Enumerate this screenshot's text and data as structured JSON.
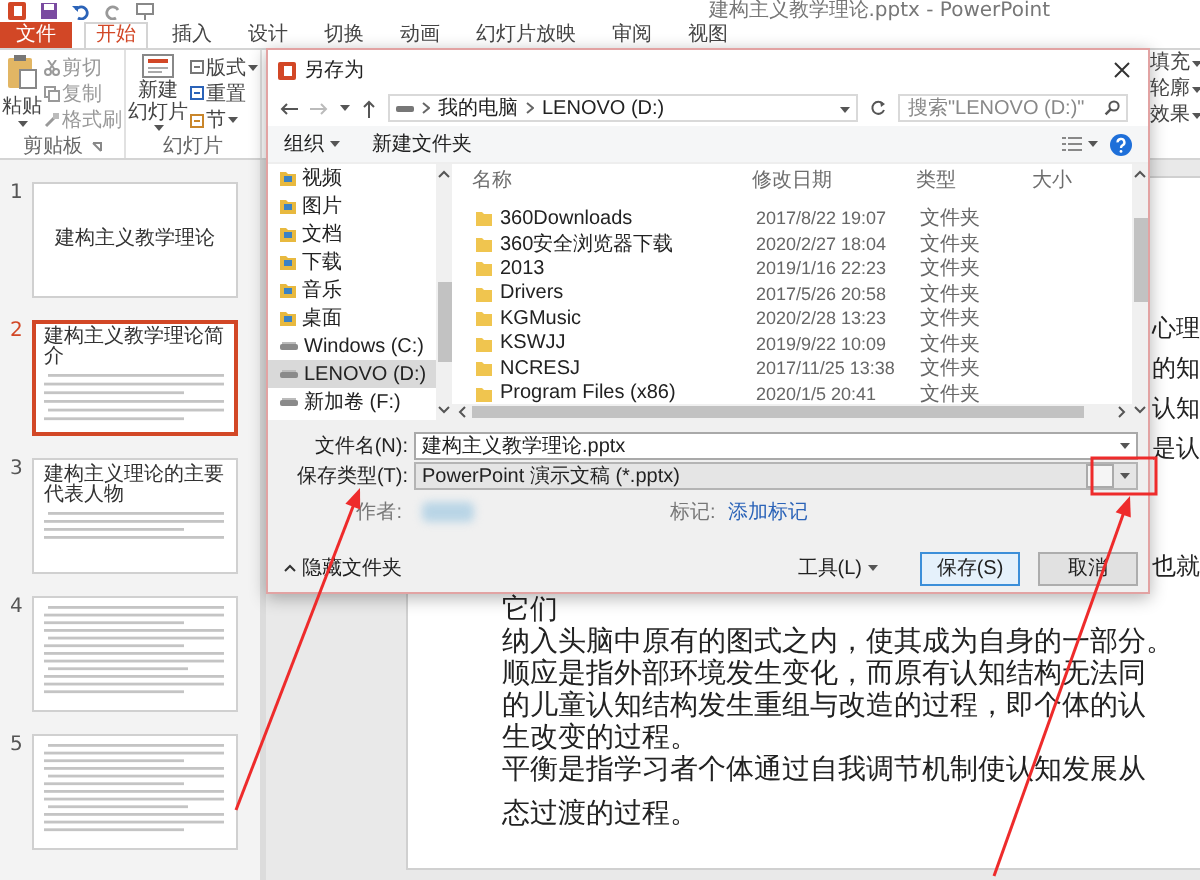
{
  "app": {
    "title": "建构主义教学理论.pptx - PowerPoint"
  },
  "ribbon_tabs": [
    {
      "label": "文件",
      "kind": "file",
      "selected": false
    },
    {
      "label": "开始",
      "kind": "tab",
      "selected": true
    },
    {
      "label": "插入",
      "kind": "tab",
      "selected": false
    },
    {
      "label": "设计",
      "kind": "tab",
      "selected": false
    },
    {
      "label": "切换",
      "kind": "tab",
      "selected": false
    },
    {
      "label": "动画",
      "kind": "tab",
      "selected": false
    },
    {
      "label": "幻灯片放映",
      "kind": "tab",
      "selected": false
    },
    {
      "label": "审阅",
      "kind": "tab",
      "selected": false
    },
    {
      "label": "视图",
      "kind": "tab",
      "selected": false
    }
  ],
  "clipboard_group": {
    "paste": "粘贴",
    "cut": "剪切",
    "copy": "复制",
    "format_painter": "格式刷",
    "label": "剪贴板"
  },
  "slides_group": {
    "new_slide": [
      "新建",
      "幻灯片"
    ],
    "layout": "版式",
    "reset": "重置",
    "section": "节",
    "label": "幻灯片"
  },
  "shape_menu": [
    "填充",
    "轮廓",
    "效果"
  ],
  "slides": [
    {
      "number": "1",
      "kind": "title",
      "title": "建构主义教学理论",
      "selected": false
    },
    {
      "number": "2",
      "kind": "content",
      "title": "建构主义教学理论简介",
      "selected": true
    },
    {
      "number": "3",
      "kind": "content",
      "title": "建构主义理论的主要代表人物",
      "selected": false
    },
    {
      "number": "4",
      "kind": "text",
      "selected": false
    },
    {
      "number": "5",
      "kind": "text",
      "selected": false
    }
  ],
  "slide_text": {
    "fragments": [
      "心理",
      "的知",
      "认知",
      "是认",
      "也就"
    ],
    "lines": [
      "它们",
      "纳入头脑中原有的图式之内，使其成为自身的一部分。",
      "顺应是指外部环境发生变化，而原有认知结构无法同",
      "的儿童认知结构发生重组与改造的过程，即个体的认",
      "生改变的过程。",
      "平衡是指学习者个体通过自我调节机制使认知发展从",
      "态过渡的过程。"
    ]
  },
  "dialog": {
    "title": "另存为",
    "path": [
      "我的电脑",
      "LENOVO (D:)"
    ],
    "search": {
      "placeholder": "搜索\"LENOVO (D:)\""
    },
    "toolbar": {
      "organize": "组织",
      "new_folder": "新建文件夹"
    },
    "sidebar": [
      {
        "label": "视频",
        "kind": "library",
        "selected": false
      },
      {
        "label": "图片",
        "kind": "library",
        "selected": false
      },
      {
        "label": "文档",
        "kind": "library",
        "selected": false
      },
      {
        "label": "下载",
        "kind": "library",
        "selected": false
      },
      {
        "label": "音乐",
        "kind": "library",
        "selected": false
      },
      {
        "label": "桌面",
        "kind": "library",
        "selected": false
      },
      {
        "label": "Windows (C:)",
        "kind": "drive",
        "selected": false
      },
      {
        "label": "LENOVO (D:)",
        "kind": "drive",
        "selected": true
      },
      {
        "label": "新加卷 (F:)",
        "kind": "drive",
        "selected": false
      }
    ],
    "columns": [
      "名称",
      "修改日期",
      "类型",
      "大小"
    ],
    "rows": [
      {
        "name": "360Downloads",
        "modified": "2017/8/22 19:07",
        "type": "文件夹"
      },
      {
        "name": "360安全浏览器下载",
        "modified": "2020/2/27 18:04",
        "type": "文件夹"
      },
      {
        "name": "2013",
        "modified": "2019/1/16 22:23",
        "type": "文件夹"
      },
      {
        "name": "Drivers",
        "modified": "2017/5/26 20:58",
        "type": "文件夹"
      },
      {
        "name": "KGMusic",
        "modified": "2020/2/28 13:23",
        "type": "文件夹"
      },
      {
        "name": "KSWJJ",
        "modified": "2019/9/22 10:09",
        "type": "文件夹"
      },
      {
        "name": "NCRESJ",
        "modified": "2017/11/25 13:38",
        "type": "文件夹"
      },
      {
        "name": "Program Files (x86)",
        "modified": "2020/1/5 20:41",
        "type": "文件夹"
      }
    ],
    "file_name": {
      "label": "文件名(N):",
      "value": "建构主义教学理论.pptx"
    },
    "save_type": {
      "label": "保存类型(T):",
      "value": "PowerPoint 演示文稿 (*.pptx)"
    },
    "author": {
      "label": "作者:"
    },
    "tags": {
      "label": "标记:",
      "link": "添加标记"
    },
    "hide_folders": "隐藏文件夹",
    "buttons": {
      "tools": "工具(L)",
      "save": "保存(S)",
      "cancel": "取消"
    }
  }
}
